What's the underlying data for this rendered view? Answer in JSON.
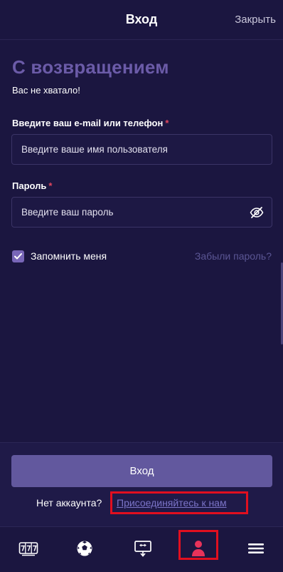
{
  "header": {
    "title": "Вход",
    "close_label": "Закрыть"
  },
  "login": {
    "welcome": "С возвращением",
    "subtitle": "Вас не хватало!",
    "email_label": "Введите ваш e-mail или телефон",
    "email_placeholder": "Введите ваше имя пользователя",
    "password_label": "Пароль",
    "password_placeholder": "Введите ваш пароль",
    "required_mark": "*",
    "remember_label": "Запомнить меня",
    "remember_checked": true,
    "forgot_label": "Забыли пароль?",
    "submit_label": "Вход",
    "no_account_text": "Нет аккаунта?",
    "join_label": "Присоединяйтесь к нам"
  },
  "bottom_nav": {
    "items": [
      {
        "name": "slots-icon"
      },
      {
        "name": "soccer-ball-icon"
      },
      {
        "name": "live-casino-icon"
      },
      {
        "name": "profile-icon",
        "active": true
      },
      {
        "name": "menu-icon"
      }
    ]
  },
  "colors": {
    "background": "#1b1640",
    "accent": "#6b5ba8",
    "button": "#62589e",
    "required": "#e0465e",
    "link": "#7b74c8",
    "highlight": "#e10f1f",
    "profile_active": "#e8335a"
  }
}
